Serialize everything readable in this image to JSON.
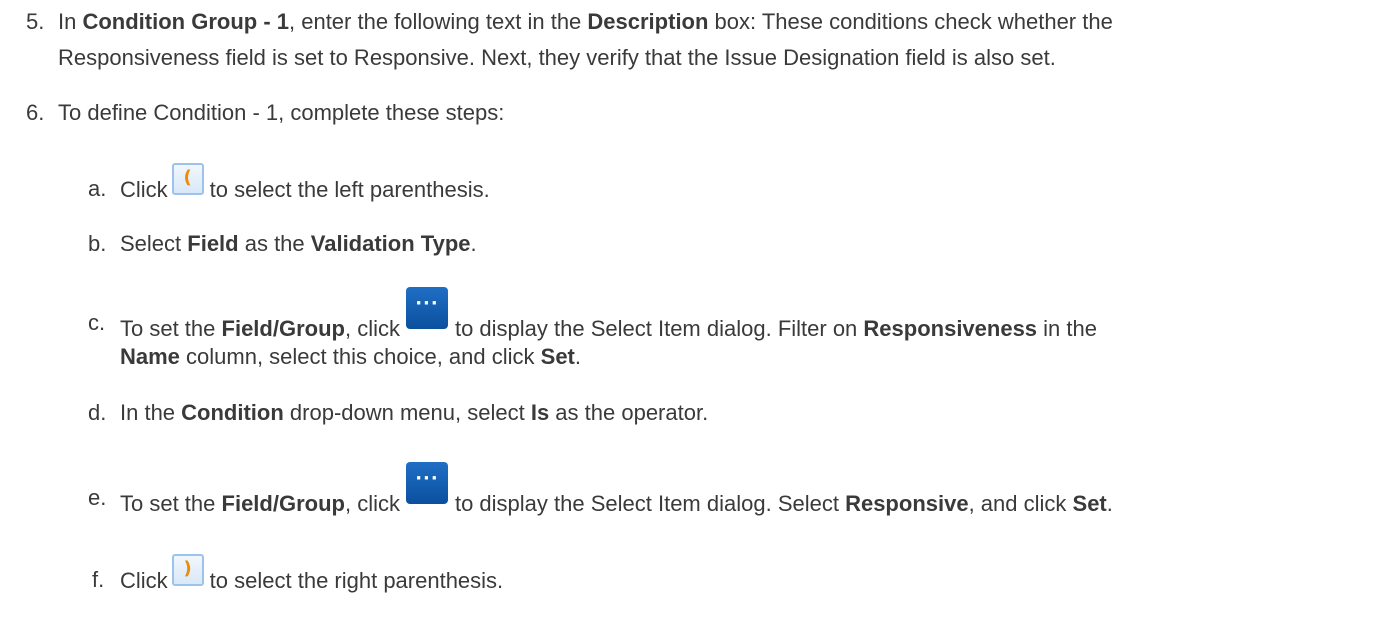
{
  "step5": {
    "number": "5.",
    "t1": "In ",
    "b1": "Condition Group - 1",
    "t2": ", enter the following text in the ",
    "b2": "Description",
    "t3": " box: These conditions check whether the",
    "line2": "Responsiveness field is set to Responsive. Next, they verify that the Issue Designation field is also set."
  },
  "step6": {
    "number": "6.",
    "text": "To define Condition - 1, complete these steps:"
  },
  "substeps": {
    "a": {
      "letter": "a.",
      "t1": "Click",
      "icon_label": "(",
      "t2": "to select the left parenthesis."
    },
    "b": {
      "letter": "b.",
      "t1": "Select ",
      "b1": "Field",
      "t2": " as the ",
      "b2": "Validation Type",
      "t3": "."
    },
    "c": {
      "letter": "c.",
      "t1": "To set the ",
      "b1": "Field/Group",
      "t2": ", click",
      "icon_label": "···",
      "t3": "to display the Select Item dialog. Filter on ",
      "b2": "Responsiveness",
      "t4": " in the",
      "line2_b1": "Name",
      "line2_t1": " column, select this choice, and click ",
      "line2_b2": "Set",
      "line2_t2": "."
    },
    "d": {
      "letter": "d.",
      "t1": "In the ",
      "b1": "Condition",
      "t2": " drop-down menu, select ",
      "b2": "Is",
      "t3": " as the operator."
    },
    "e": {
      "letter": "e.",
      "t1": "To set the ",
      "b1": "Field/Group",
      "t2": ", click",
      "icon_label": "···",
      "t3": "to display the Select Item dialog. Select ",
      "b2": "Responsive",
      "t4": ", and click ",
      "b3": "Set",
      "t5": "."
    },
    "f": {
      "letter": "f.",
      "t1": "Click",
      "icon_label": ")",
      "t2": "to select the right parenthesis."
    }
  },
  "colors": {
    "text": "#3a3a3a",
    "paren_icon_accent": "#f08a00",
    "dots_button_bg": "#0b4f9f"
  }
}
